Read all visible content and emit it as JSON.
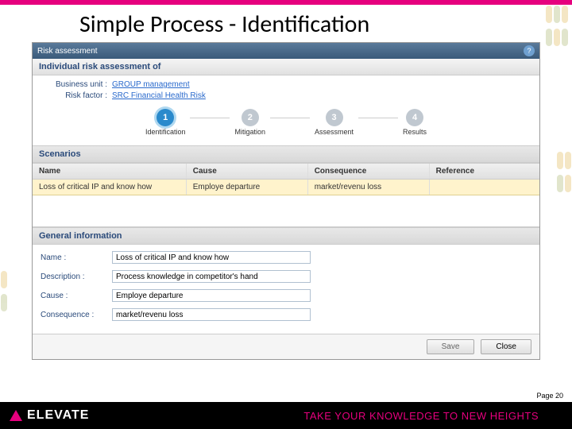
{
  "slide": {
    "title": "Simple Process - Identification",
    "page_label": "Page 20"
  },
  "app": {
    "titlebar": "Risk assessment",
    "subheader": "Individual risk assessment of",
    "business_unit_label": "Business unit :",
    "business_unit_value": "GROUP management",
    "risk_factor_label": "Risk factor :",
    "risk_factor_value": "SRC Financial Health Risk"
  },
  "steps": [
    {
      "num": "1",
      "label": "Identification",
      "active": true
    },
    {
      "num": "2",
      "label": "Mitigation",
      "active": false
    },
    {
      "num": "3",
      "label": "Assessment",
      "active": false
    },
    {
      "num": "4",
      "label": "Results",
      "active": false
    }
  ],
  "scenarios": {
    "section_title": "Scenarios",
    "headers": {
      "name": "Name",
      "cause": "Cause",
      "consequence": "Consequence",
      "reference": "Reference"
    },
    "rows": [
      {
        "name": "Loss of critical IP and know how",
        "cause": "Employe departure",
        "consequence": "market/revenu loss",
        "reference": ""
      }
    ]
  },
  "general": {
    "section_title": "General information",
    "labels": {
      "name": "Name :",
      "description": "Description :",
      "cause": "Cause :",
      "consequence": "Consequence :"
    },
    "values": {
      "name": "Loss of critical IP and know how",
      "description": "Process knowledge in competitor's hand",
      "cause": "Employe departure",
      "consequence": "market/revenu loss"
    }
  },
  "buttons": {
    "save": "Save",
    "close": "Close"
  },
  "footer": {
    "logo": "ELEVATE",
    "tagline": "TAKE YOUR KNOWLEDGE TO NEW HEIGHTS"
  }
}
